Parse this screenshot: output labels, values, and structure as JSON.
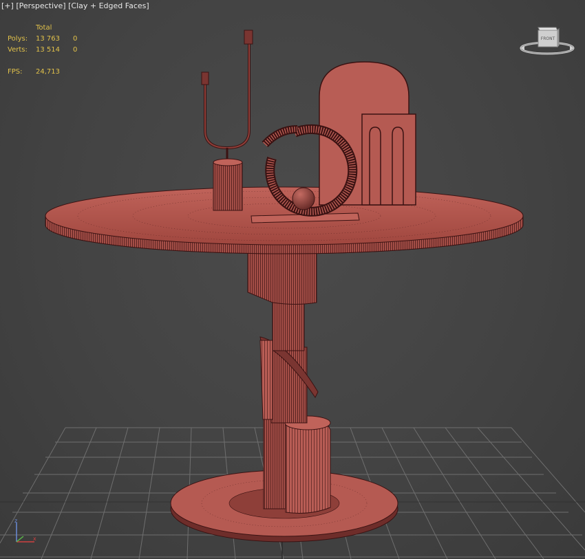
{
  "viewport": {
    "label_plus": "[+]",
    "label_view": "[Perspective]",
    "label_shading": "[Clay + Edged Faces]"
  },
  "stats": {
    "header": "Total",
    "rows": [
      {
        "label": "Polys:",
        "total": "13 763",
        "selected": "0"
      },
      {
        "label": "Verts:",
        "total": "13 514",
        "selected": "0"
      }
    ],
    "fps_label": "FPS:",
    "fps_value": "24,713",
    "color": "#e2c24a"
  },
  "viewcube": {
    "face_label": "FRONT"
  },
  "axis": {
    "z": "z",
    "x": "x"
  },
  "colors": {
    "clay": "#b55a52",
    "clay_dark": "#7a3531",
    "edge": "#3a1212",
    "grid": "#6f6f6f",
    "background": "#434343"
  },
  "icons": [
    "viewcube-icon",
    "axis-tripod-icon"
  ]
}
